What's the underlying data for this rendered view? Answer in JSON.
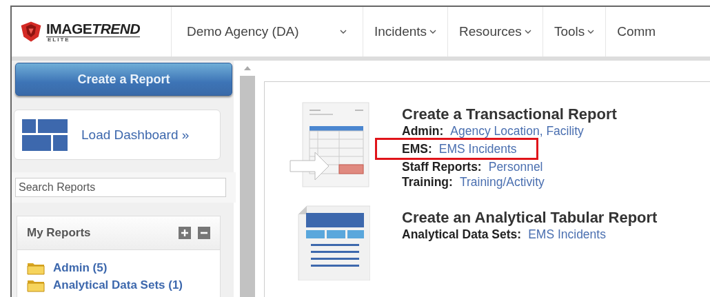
{
  "header": {
    "logo": {
      "wordmark_plain": "IMAGE",
      "wordmark_italic": "TREND",
      "tagline": "ELITE"
    },
    "nav": [
      {
        "label": "Demo Agency (DA)",
        "kind": "agency"
      },
      {
        "label": "Incidents",
        "kind": "menu"
      },
      {
        "label": "Resources",
        "kind": "menu"
      },
      {
        "label": "Tools",
        "kind": "menu"
      },
      {
        "label": "Comm",
        "kind": "cut"
      }
    ]
  },
  "sidebar": {
    "create_button": "Create a Report",
    "dashboard_link": "Load Dashboard »",
    "search": {
      "placeholder": "Search Reports"
    },
    "my_reports": {
      "title": "My Reports",
      "folders": [
        {
          "label": "Admin (5)"
        },
        {
          "label": "Analytical Data Sets (1)"
        }
      ]
    }
  },
  "main": {
    "sections": [
      {
        "kind": "transactional",
        "title": "Create a Transactional Report",
        "lines": [
          {
            "label": "Admin:",
            "link": "Agency Location, Facility",
            "highlighted": false
          },
          {
            "label": "EMS:",
            "link": "EMS Incidents",
            "highlighted": true
          },
          {
            "label": "Staff Reports:",
            "link": "Personnel",
            "highlighted": false
          },
          {
            "label": "Training:",
            "link": "Training/Activity",
            "highlighted": false
          }
        ]
      },
      {
        "kind": "tabular",
        "title": "Create an Analytical Tabular Report",
        "lines": [
          {
            "label": "Analytical Data Sets:",
            "link": "EMS Incidents",
            "highlighted": false
          }
        ]
      }
    ]
  }
}
